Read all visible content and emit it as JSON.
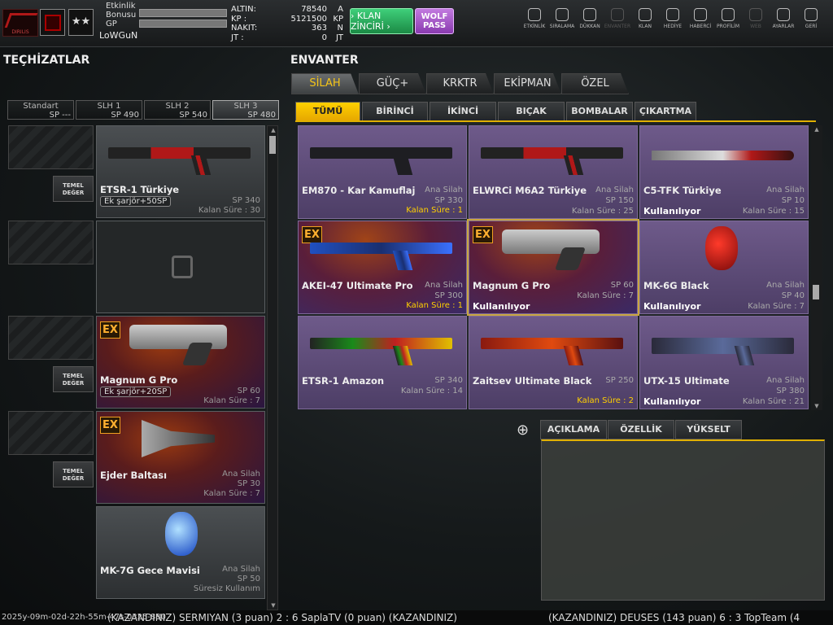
{
  "player": {
    "labels": [
      "Etkinlik",
      "Bonusu",
      "GP"
    ],
    "name": "LoWGuN",
    "logo_text": "DIRILIS",
    "emblem_stars": "★★"
  },
  "currency": [
    {
      "k": "ALTIN:",
      "v": "78540",
      "u": "A"
    },
    {
      "k": "KP  :",
      "v": "5121500",
      "u": "KP"
    },
    {
      "k": "NAKIT:",
      "v": "363",
      "u": "N"
    },
    {
      "k": "JT  :",
      "v": "0",
      "u": "JT"
    }
  ],
  "klan_button": "› KLAN ZİNCİRİ ›",
  "wolf_button": "WOLF PASS",
  "nav": [
    "ETKİNLİK",
    "SIRALAMA",
    "DÜKKAN",
    "ENVANTER",
    "KLAN",
    "HEDİYE",
    "HABERCİ",
    "PROFİLİM",
    "WEB",
    "AYARLAR",
    "GERİ"
  ],
  "left": {
    "title": "TEÇHİZATLAR",
    "slots": [
      {
        "n": "Standart",
        "sp": "SP ---"
      },
      {
        "n": "SLH 1",
        "sp": "SP 490"
      },
      {
        "n": "SLH 2",
        "sp": "SP 540"
      },
      {
        "n": "SLH 3",
        "sp": "SP 480"
      }
    ],
    "temel": "TEMEL DEĞER",
    "cards": [
      {
        "name": "ETSR-1 Türkiye",
        "badge": "Ek şarjör+50SP",
        "sp": "SP 340",
        "time": "Kalan Süre : 30"
      },
      {
        "name": "Magnum G Pro",
        "badge": "Ek şarjör+20SP",
        "sp": "SP 60",
        "time": "Kalan Süre : 7"
      },
      {
        "name": "Ejder Baltası",
        "role": "Ana Silah",
        "sp": "SP 30",
        "time": "Kalan Süre : 7"
      },
      {
        "name": "MK-7G Gece Mavisi",
        "role": "Ana Silah",
        "sp": "SP 50",
        "time": "Süresiz Kullanım"
      }
    ]
  },
  "right": {
    "title": "ENVANTER",
    "tabs": [
      "SİLAH",
      "GÜÇ+",
      "KRKTR",
      "EKİPMAN",
      "ÖZEL"
    ],
    "subtabs": [
      "TÜMÜ",
      "BİRİNCİ",
      "İKİNCİ",
      "BIÇAK",
      "BOMBALAR",
      "ÇIKARTMA"
    ],
    "items": [
      {
        "name": "EM870 - Kar Kamuflaj",
        "role": "Ana Silah",
        "sp": "SP 330",
        "status": "",
        "time": "Kalan Süre : 1"
      },
      {
        "name": "ELWRCi M6A2 Türkiye",
        "role": "Ana Silah",
        "sp": "SP 150",
        "status": "",
        "time": "Kalan Süre : 25"
      },
      {
        "name": "C5-TFK Türkiye",
        "role": "Ana Silah",
        "sp": "SP 10",
        "status": "Kullanılıyor",
        "time": "Kalan Süre : 15"
      },
      {
        "name": "AKEI-47 Ultimate Pro",
        "role": "Ana Silah",
        "sp": "SP 300",
        "status": "",
        "time": "Kalan Süre : 1"
      },
      {
        "name": "Magnum G Pro",
        "role": "",
        "sp": "SP 60",
        "status": "Kullanılıyor",
        "time": "Kalan Süre : 7"
      },
      {
        "name": "MK-6G Black",
        "role": "Ana Silah",
        "sp": "SP 40",
        "status": "Kullanılıyor",
        "time": "Kalan Süre : 7"
      },
      {
        "name": "ETSR-1 Amazon",
        "role": "",
        "sp": "SP 340",
        "status": "",
        "time": "Kalan Süre : 14"
      },
      {
        "name": "Zaitsev Ultimate Black",
        "role": "",
        "sp": "SP 250",
        "status": "",
        "time": "Kalan Süre : 2"
      },
      {
        "name": "UTX-15 Ultimate",
        "role": "Ana Silah",
        "sp": "SP 380",
        "status": "Kullanılıyor",
        "time": "Kalan Süre : 21"
      }
    ],
    "desc_tabs": [
      "AÇIKLAMA",
      "ÖZELLİK",
      "YÜKSELT"
    ]
  },
  "ticker": {
    "a": "(KAZANDINIZ) SERMIYAN (3 puan) 2 : 6 SaplaTV (0 puan) (KAZANDINIZ)",
    "b": "(KAZANDINIZ) DEUSES (143 puan) 6 : 3 TopTeam (4",
    "stamp": "2025y-09m-02d-22h-55m-47s-0325-880"
  }
}
